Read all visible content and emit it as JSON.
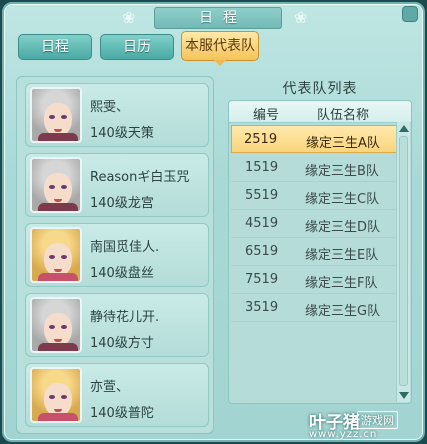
{
  "window": {
    "title": "日程"
  },
  "tabs": [
    {
      "label": "日程",
      "active": false
    },
    {
      "label": "日历",
      "active": false
    },
    {
      "label": "本服代表队",
      "active": true
    }
  ],
  "players": [
    {
      "name": "熙雯、",
      "level": "140级天策",
      "portrait": "grey-hair-male"
    },
    {
      "name": "Reasonギ白玉咒",
      "level": "140级龙宫",
      "portrait": "grey-hair-male"
    },
    {
      "name": "南国觅佳人.",
      "level": "140级盘丝",
      "portrait": "blonde-hair-female"
    },
    {
      "name": "静待花儿开.",
      "level": "140级方寸",
      "portrait": "grey-hair-male"
    },
    {
      "name": "亦萱、",
      "level": "140级普陀",
      "portrait": "blonde-hair-female"
    }
  ],
  "team_list": {
    "title": "代表队列表",
    "columns": [
      "编号",
      "队伍名称"
    ],
    "rows": [
      {
        "id": "2519",
        "name": "缘定三生A队",
        "selected": true
      },
      {
        "id": "1519",
        "name": "缘定三生B队",
        "selected": false
      },
      {
        "id": "5519",
        "name": "缘定三生C队",
        "selected": false
      },
      {
        "id": "4519",
        "name": "缘定三生D队",
        "selected": false
      },
      {
        "id": "6519",
        "name": "缘定三生E队",
        "selected": false
      },
      {
        "id": "7519",
        "name": "缘定三生F队",
        "selected": false
      },
      {
        "id": "3519",
        "name": "缘定三生G队",
        "selected": false
      }
    ]
  },
  "watermark": {
    "brand": "叶子猪",
    "sub": "游戏网",
    "url": "www.yzz.cn"
  },
  "colors": {
    "accent": "#f6c35a",
    "panel": "#a9d9d6",
    "text": "#2c4240"
  }
}
